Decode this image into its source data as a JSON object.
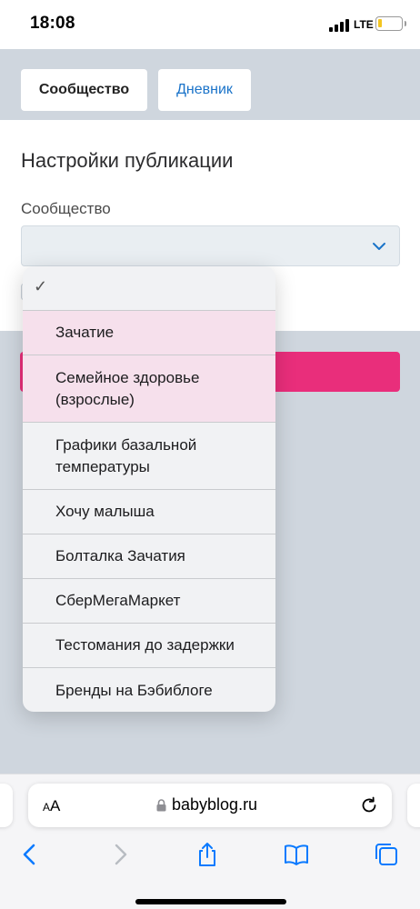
{
  "status_bar": {
    "time": "18:08",
    "network": "LTE"
  },
  "tabs": {
    "community": "Сообщество",
    "diary": "Дневник"
  },
  "settings": {
    "title": "Настройки публикации",
    "community_label": "Сообщество",
    "community_value": ""
  },
  "dropdown": {
    "selected_mark": "✓",
    "options": [
      "Зачатие",
      "Семейное здоровье (взрослые)",
      "Графики базальной температуры",
      "Хочу малыша",
      "Болталка Зачатия",
      "СберМегаМаркет",
      "Тестомания до задержки",
      "Бренды на Бэбиблоге"
    ],
    "highlighted": [
      "Зачатие",
      "Семейное здоровье (взрослые)"
    ]
  },
  "browser": {
    "text_size_label_small": "A",
    "text_size_label_large": "A",
    "url": "babyblog.ru"
  },
  "colors": {
    "accent_pink": "#e92e7b",
    "link_blue": "#1a73c9",
    "ios_blue": "#0a7aff"
  },
  "icons": [
    "signal-icon",
    "battery-icon",
    "chevron-down-icon",
    "lock-icon",
    "reload-icon",
    "back-icon",
    "forward-icon",
    "share-icon",
    "bookmarks-icon",
    "tabs-icon"
  ]
}
